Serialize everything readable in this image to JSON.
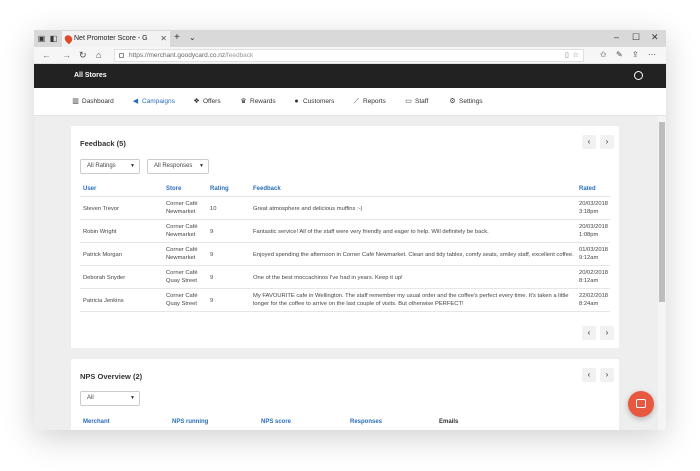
{
  "browser": {
    "tab_title": "Net Promoter Score - G",
    "url_host": "https://merchant.goodycard.co.nz",
    "url_path": "/feedback"
  },
  "app": {
    "title": "All Stores",
    "accent": "#2a6ebb",
    "chat_color": "#e8573f"
  },
  "nav": [
    {
      "label": "Dashboard",
      "icon": "bar-chart-icon",
      "glyph": "▥"
    },
    {
      "label": "Campaigns",
      "icon": "megaphone-icon",
      "glyph": "◀"
    },
    {
      "label": "Offers",
      "icon": "tag-icon",
      "glyph": "❖"
    },
    {
      "label": "Rewards",
      "icon": "trophy-icon",
      "glyph": "♛"
    },
    {
      "label": "Customers",
      "icon": "users-icon",
      "glyph": "👥"
    },
    {
      "label": "Reports",
      "icon": "line-chart-icon",
      "glyph": "⟋"
    },
    {
      "label": "Staff",
      "icon": "id-card-icon",
      "glyph": "▭"
    },
    {
      "label": "Settings",
      "icon": "gears-icon",
      "glyph": "⚙"
    }
  ],
  "feedback": {
    "title": "Feedback (5)",
    "filter_rating": "All Ratings",
    "filter_responses": "All Responses",
    "columns": [
      "User",
      "Store",
      "Rating",
      "Feedback",
      "Rated"
    ],
    "rows": [
      {
        "user": "Steven Trevor",
        "store1": "Corner Café",
        "store2": "Newmarket",
        "rating": "10",
        "feedback1": "Great atmosphere and delicious muffins :-)",
        "feedback2": "",
        "date": "20/03/2018",
        "time": "3:18pm"
      },
      {
        "user": "Robin Wright",
        "store1": "Corner Café",
        "store2": "Newmarket",
        "rating": "9",
        "feedback1": "Fantastic service! All of the staff were very friendly and eager to help. Will definitely be back.",
        "feedback2": "",
        "date": "20/03/2018",
        "time": "1:08pm"
      },
      {
        "user": "Patrick Morgan",
        "store1": "Corner Café Newmarket",
        "store2": "",
        "rating": "9",
        "feedback1": "Enjoyed spending the afternoon in Corner Café Newmarket. Clean and tidy tables, comfy seats, smiley staff, excellent coffee.",
        "feedback2": "",
        "date": "01/03/2018",
        "time": "9:12am"
      },
      {
        "user": "Deborah Snyder",
        "store1": "Corner Café",
        "store2": "Quay Street",
        "rating": "9",
        "feedback1": "One of the best moccachinos I've had in years. Keep it up!",
        "feedback2": "",
        "date": "20/02/2018",
        "time": "8:12am"
      },
      {
        "user": "Patricia Jenkins",
        "store1": "Corner Café",
        "store2": "Quay Street",
        "rating": "9",
        "feedback1": "My FAVOURITE cafe in Wellington. The staff remember my usual order and the coffee's perfect every time. It's taken a little",
        "feedback2": "longer for the coffee to arrive on the last couple of visits. But otherwise PERFECT!",
        "date": "22/02/2018",
        "time": "8:24am"
      }
    ]
  },
  "nps": {
    "title": "NPS Overview (2)",
    "filter": "All",
    "columns": [
      "Merchant",
      "NPS running",
      "NPS score",
      "Responses",
      "Emails"
    ]
  }
}
